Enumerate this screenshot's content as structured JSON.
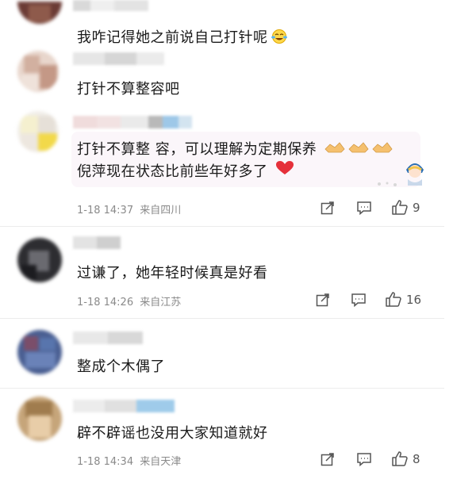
{
  "comments": [
    {
      "text": "我咋记得她之前说自己打针呢"
    },
    {
      "text": "打针不算整容吧"
    },
    {
      "line1": "打针不算整 容，可以理解为定期保养",
      "line2": "倪萍现在状态比前些年好多了",
      "time": "1-18 14:37",
      "location": "来自四川",
      "likes": "9"
    },
    {
      "text": "过谦了，她年轻时候真是好看",
      "time": "1-18 14:26",
      "location": "来自江苏",
      "likes": "16"
    },
    {
      "text": "整成个木偶了"
    },
    {
      "text": "辟不辟谣也没用大家知道就好",
      "time": "1-18 14:34",
      "location": "来自天津",
      "likes": "8"
    }
  ]
}
